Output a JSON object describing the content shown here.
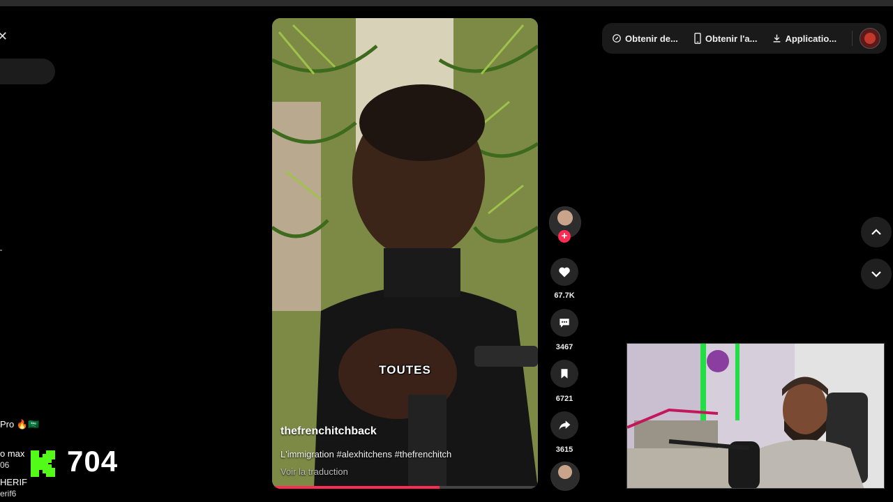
{
  "header": {
    "items": [
      {
        "label": "Obtenir de...",
        "icon": "coin-icon"
      },
      {
        "label": "Obtenir l'a...",
        "icon": "phone-icon"
      },
      {
        "label": "Applicatio...",
        "icon": "download-icon"
      }
    ]
  },
  "video": {
    "author": "thefrenchitchback",
    "description": "L'immigration #alexhitchens #thefrenchitch",
    "translate": "Voir la traduction",
    "caption": "TOUTES",
    "progress": 0.63
  },
  "actions": {
    "likes": "67.7K",
    "comments": "3467",
    "saves": "6721",
    "shares": "3615"
  },
  "chat": {
    "line1": "Pro 🔥🇸🇦",
    "line2": "o max",
    "line2_sub": "06",
    "line3": "HERIF",
    "line3_sub": "erif6"
  },
  "kick": {
    "count": "704",
    "color": "#53fc18"
  },
  "colors": {
    "accent": "#fe2c55",
    "background": "#000000"
  }
}
